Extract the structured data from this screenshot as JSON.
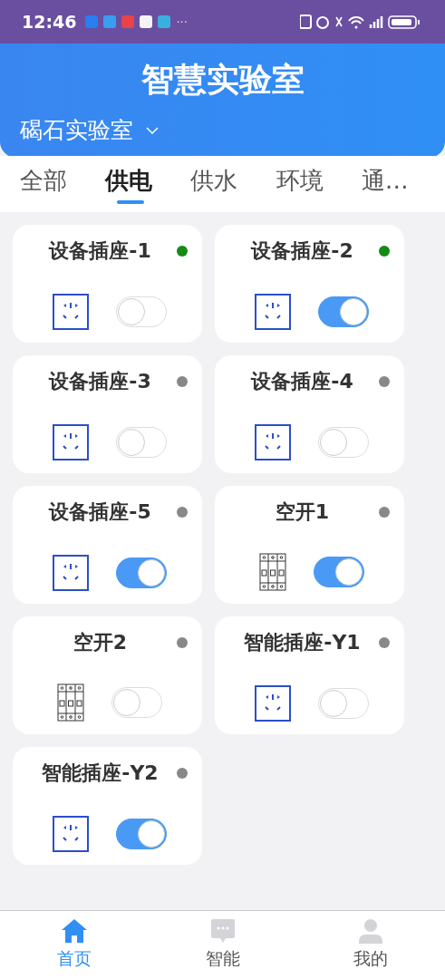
{
  "status_bar": {
    "time": "12:46",
    "more": "···"
  },
  "header": {
    "title": "智慧实验室",
    "lab": "碣石实验室"
  },
  "tabs": [
    {
      "label": "全部",
      "selected": false
    },
    {
      "label": "供电",
      "selected": true
    },
    {
      "label": "供水",
      "selected": false
    },
    {
      "label": "环境",
      "selected": false
    },
    {
      "label": "通…",
      "selected": false
    }
  ],
  "devices": [
    {
      "name": "设备插座-1",
      "kind": "socket",
      "online": true,
      "on": false
    },
    {
      "name": "设备插座-2",
      "kind": "socket",
      "online": true,
      "on": true
    },
    {
      "name": "设备插座-3",
      "kind": "socket",
      "online": false,
      "on": false
    },
    {
      "name": "设备插座-4",
      "kind": "socket",
      "online": false,
      "on": false
    },
    {
      "name": "设备插座-5",
      "kind": "socket",
      "online": false,
      "on": true
    },
    {
      "name": "空开1",
      "kind": "breaker",
      "online": false,
      "on": true
    },
    {
      "name": "空开2",
      "kind": "breaker",
      "online": false,
      "on": false
    },
    {
      "name": "智能插座-Y1",
      "kind": "socket",
      "online": false,
      "on": false
    },
    {
      "name": "智能插座-Y2",
      "kind": "socket",
      "online": false,
      "on": true
    }
  ],
  "nav": [
    {
      "label": "首页",
      "kind": "home",
      "selected": true
    },
    {
      "label": "智能",
      "kind": "chat",
      "selected": false
    },
    {
      "label": "我的",
      "kind": "user",
      "selected": false
    }
  ]
}
